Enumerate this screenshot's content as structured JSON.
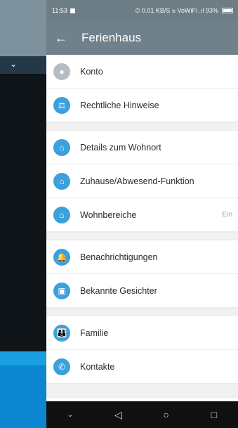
{
  "status": {
    "time": "11:53",
    "icons": "⏱ 0.01 KB/S ≋ VoWiFi .ıl 93%"
  },
  "appbar": {
    "title": "Ferienhaus"
  },
  "items": [
    {
      "label": "Konto",
      "icon": "account-icon"
    },
    {
      "label": "Rechtliche Hinweise",
      "icon": "legal-icon"
    },
    {
      "label": "Details zum Wohnort",
      "icon": "home-details-icon"
    },
    {
      "label": "Zuhause/Abwesend-Funktion",
      "icon": "home-away-icon"
    },
    {
      "label": "Wohnbereiche",
      "value": "Ein",
      "icon": "rooms-icon"
    },
    {
      "label": "Benachrichtigungen",
      "icon": "bell-icon"
    },
    {
      "label": "Bekannte Gesichter",
      "icon": "faces-icon"
    },
    {
      "label": "Familie",
      "icon": "family-icon"
    },
    {
      "label": "Kontakte",
      "icon": "phone-icon"
    }
  ]
}
